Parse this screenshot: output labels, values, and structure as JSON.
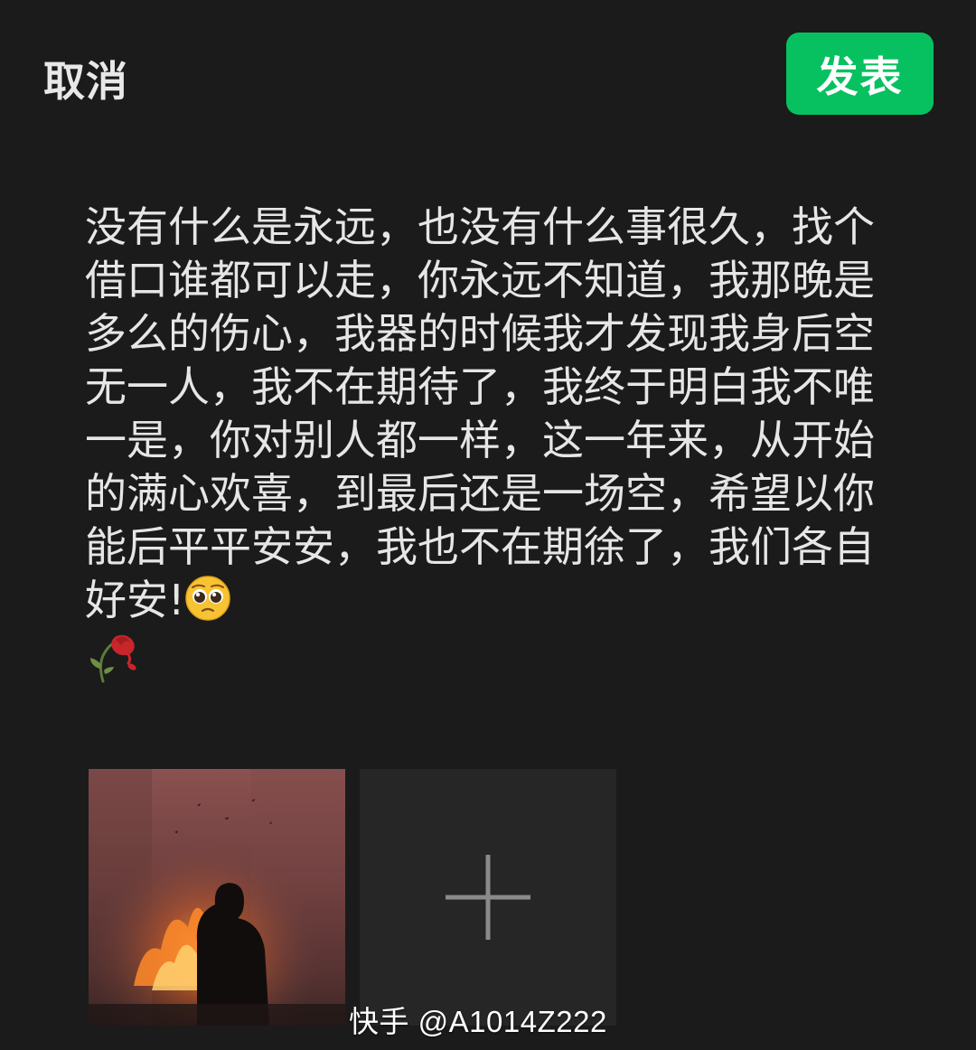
{
  "header": {
    "cancel_label": "取消",
    "post_label": "发表"
  },
  "post": {
    "text": "没有什么是永远，也没有什么事很久，找个借口谁都可以走，你永远不知道，我那晚是多么的伤心，我器的时候我才发现我身后空无一人，我不在期待了，我终于明白我不唯一是，你对别人都一样，这一年来，从开始的满心欢喜，到最后还是一场空，希望以你能后平平安安，我也不在期徐了，我们各自好安!",
    "emojis": [
      "pleading-face-icon",
      "wilted-rose-icon"
    ]
  },
  "media": {
    "thumbnail_icon": "photo-thumbnail",
    "add_icon": "plus-icon"
  },
  "watermark": {
    "text": "快手 @A1014Z222"
  },
  "colors": {
    "background": "#1b1b1b",
    "accent": "#07c160",
    "text": "#e6e6e6",
    "tile": "#262626"
  }
}
